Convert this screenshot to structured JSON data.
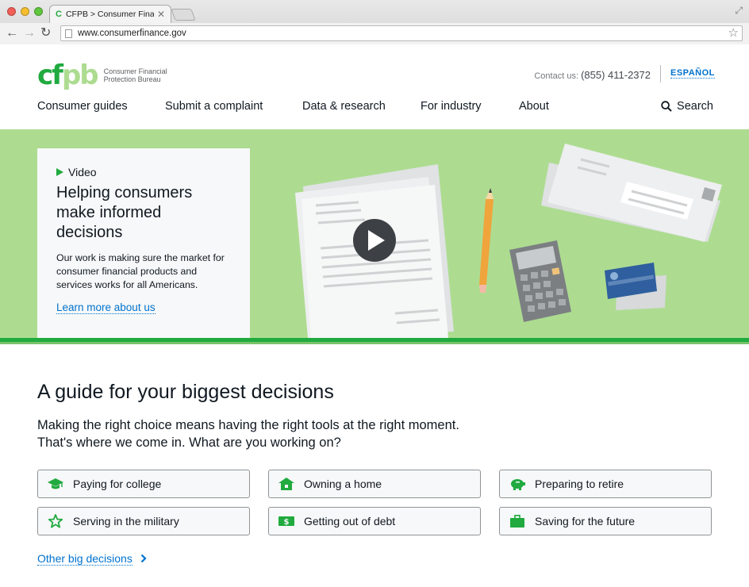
{
  "browser": {
    "tab_title": "CFPB > Consumer Financial",
    "tab_favicon": "C",
    "url": "www.consumerfinance.gov"
  },
  "header": {
    "logo_text": "cfpb",
    "logo_name": "Consumer Financial Protection Bureau",
    "contact_label": "Contact us:",
    "contact_phone": "(855) 411-2372",
    "language_link": "ESPAÑOL"
  },
  "nav": {
    "items": [
      "Consumer guides",
      "Submit a complaint",
      "Data & research",
      "For industry",
      "About"
    ],
    "search_label": "Search"
  },
  "hero": {
    "kicker": "Video",
    "title": "Helping consumers make informed decisions",
    "description": "Our work is making sure the market for consumer financial products and services works for all Americans.",
    "link": "Learn more about us"
  },
  "guides": {
    "heading": "A guide for your biggest decisions",
    "intro": "Making the right choice means having the right tools at the right moment. That's where we come in. What are you working on?",
    "buttons": [
      {
        "label": "Paying for college",
        "icon": "graduation-cap-icon"
      },
      {
        "label": "Owning a home",
        "icon": "house-icon"
      },
      {
        "label": "Preparing to retire",
        "icon": "piggy-bank-icon"
      },
      {
        "label": "Serving in the military",
        "icon": "star-icon"
      },
      {
        "label": "Getting out of debt",
        "icon": "money-icon"
      },
      {
        "label": "Saving for the future",
        "icon": "briefcase-icon"
      }
    ],
    "other_link": "Other big decisions"
  },
  "colors": {
    "brand_green": "#20aa3f",
    "light_green": "#addc91",
    "link_blue": "#0072ce",
    "text": "#101820"
  }
}
